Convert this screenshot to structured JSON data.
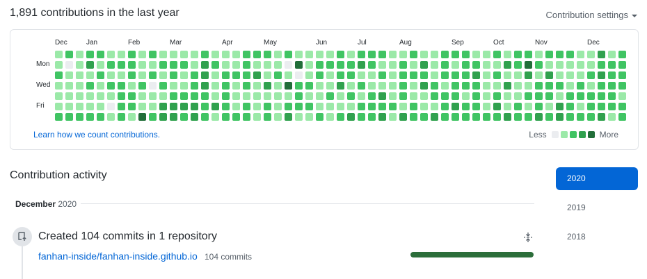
{
  "header": {
    "title": "1,891 contributions in the last year",
    "settings_label": "Contribution settings"
  },
  "graph": {
    "months": [
      "Dec",
      "Jan",
      "Feb",
      "Mar",
      "Apr",
      "May",
      "Jun",
      "Jul",
      "Aug",
      "Sep",
      "Oct",
      "Nov",
      "Dec"
    ],
    "month_start_weeks": [
      0,
      3,
      7,
      11,
      16,
      20,
      25,
      29,
      33,
      38,
      42,
      46,
      51
    ],
    "day_labels": [
      "Mon",
      "Wed",
      "Fri"
    ],
    "colors": [
      "#ebedf0",
      "#9be9a8",
      "#40c463",
      "#30a14e",
      "#216e39"
    ],
    "levels": [
      "1212211212111121112221211112122211211222112122122211312",
      "1013122211222132112111041222232112131212211324211111222",
      "2111211212121231222312101212211212221222312113131112322",
      "1112122120211231212131422113121112132122211311222121222",
      "1111112211122221211111121121212312112221212112221222221",
      "1111102211333323212121222111122221211232213121213212222",
      "2222212142332321222121311212322313223222222322323222312"
    ],
    "learn_link": "Learn how we count contributions.",
    "legend_less": "Less",
    "legend_more": "More"
  },
  "activity": {
    "title": "Contribution activity",
    "month": "December",
    "year": "2020",
    "event_title": "Created 104 commits in 1 repository",
    "repo": "fanhan-inside/fanhan-inside.github.io",
    "repo_commits": "104 commits",
    "repo_share": 1.0
  },
  "years": [
    "2020",
    "2019",
    "2018"
  ],
  "selected_year": "2020"
}
